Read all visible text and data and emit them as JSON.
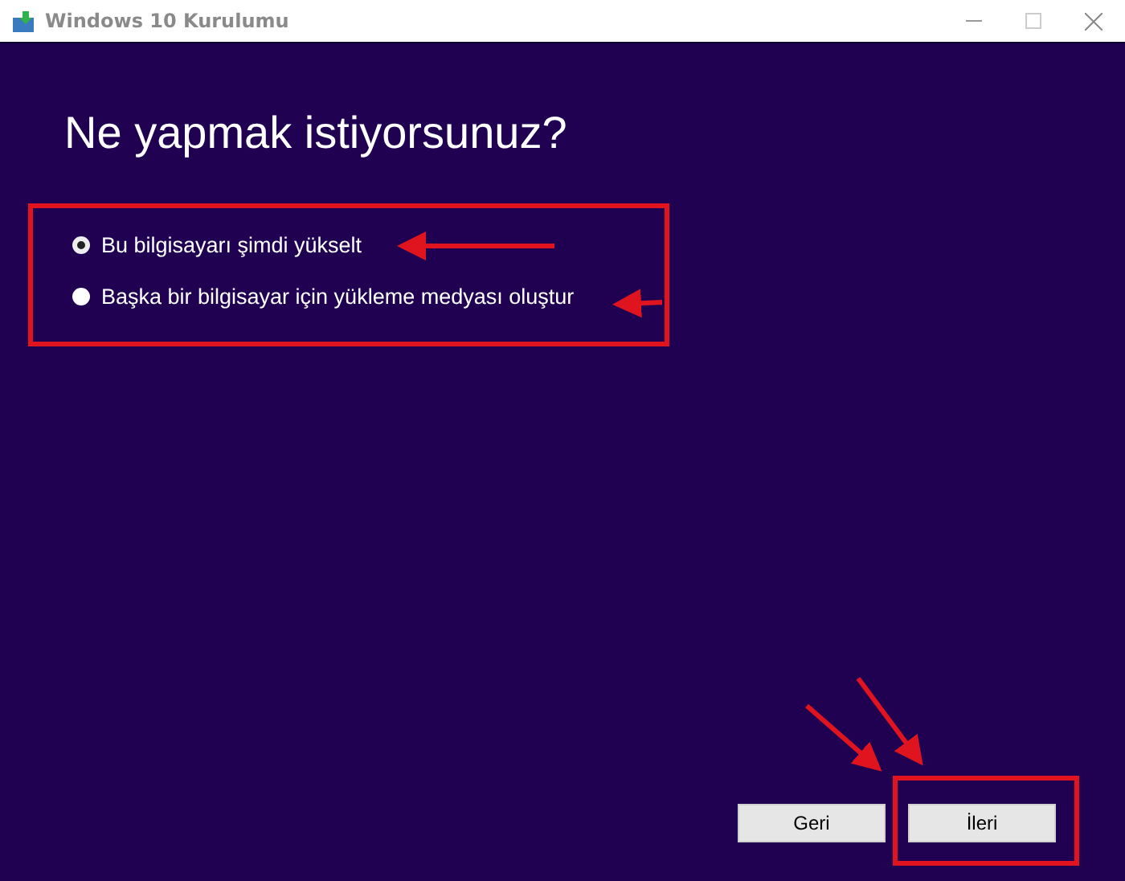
{
  "window": {
    "title": "Windows 10 Kurulumu"
  },
  "heading": "Ne yapmak istiyorsunuz?",
  "options": [
    {
      "label": "Bu bilgisayarı şimdi yükselt",
      "selected": true
    },
    {
      "label": "Başka bir bilgisayar için yükleme medyası oluştur",
      "selected": false
    }
  ],
  "buttons": [
    {
      "label": "Geri"
    },
    {
      "label": "İleri"
    }
  ]
}
